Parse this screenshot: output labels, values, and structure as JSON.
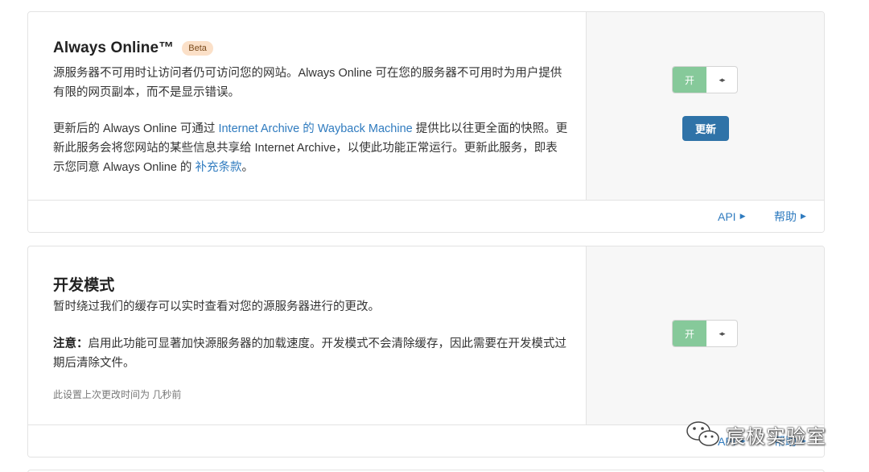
{
  "always_online": {
    "title": "Always Online™",
    "badge": "Beta",
    "desc_1": "源服务器不可用时让访问者仍可访问您的网站。Always Online 可在您的服务器不可用时为用户提供有限的网页副本，而不是显示错误。",
    "desc_2_prefix": "更新后的 Always Online 可通过 ",
    "desc_2_link": "Internet Archive 的 Wayback Machine",
    "desc_2_mid": " 提供比以往更全面的快照。更新此服务会将您网站的某些信息共享给 Internet Archive，以使此功能正常运行。更新此服务，即表示您同意 Always Online 的 ",
    "desc_2_link2": "补充条款",
    "desc_2_suffix": "。",
    "toggle_label": "开",
    "toggle_knob": "◂▸",
    "update_button": "更新",
    "footer_api": "API",
    "footer_help": "帮助"
  },
  "dev_mode": {
    "title": "开发模式",
    "desc_1": "暂时绕过我们的缓存可以实时查看对您的源服务器进行的更改。",
    "note_label": "注意：",
    "note_text": "启用此功能可显著加快源服务器的加载速度。开发模式不会清除缓存，因此需要在开发模式过期后清除文件。",
    "last_changed": "此设置上次更改时间为 几秒前",
    "toggle_label": "开",
    "toggle_knob": "◂▸",
    "footer_api": "API",
    "footer_help": "帮助"
  },
  "watermark": {
    "text": "宸极实验室"
  },
  "icons": {
    "arrow": "right-triangle-icon",
    "watermark_logo": "wechat-icon"
  }
}
